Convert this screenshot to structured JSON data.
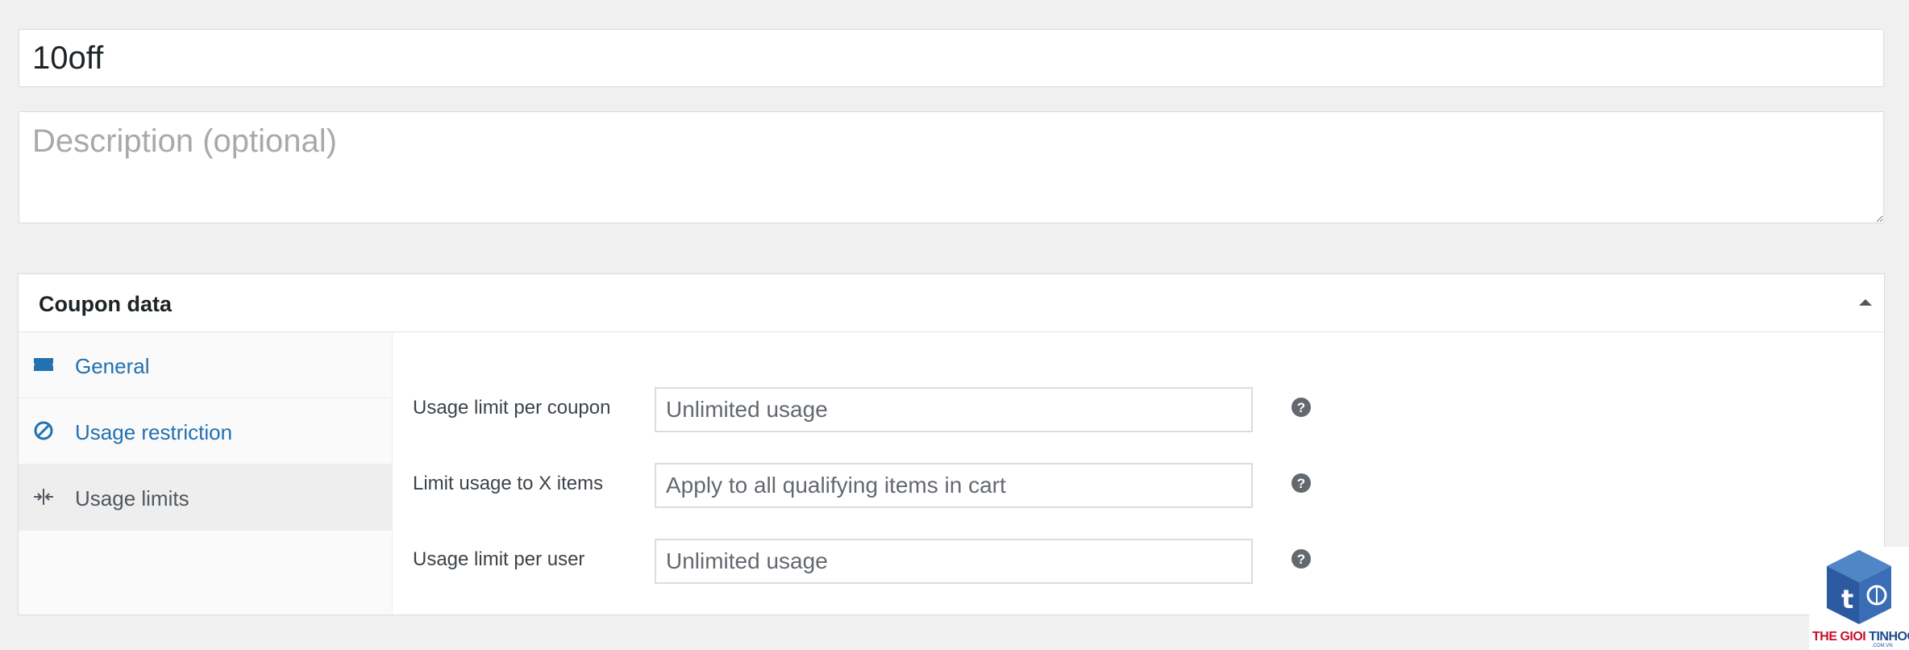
{
  "coupon": {
    "code": "10off",
    "description_placeholder": "Description (optional)"
  },
  "metabox": {
    "title": "Coupon data"
  },
  "tabs": [
    {
      "label": "General",
      "icon": "ticket-icon"
    },
    {
      "label": "Usage restriction",
      "icon": "prohibited-icon"
    },
    {
      "label": "Usage limits",
      "icon": "limits-icon",
      "active": true
    }
  ],
  "fields": [
    {
      "label": "Usage limit per coupon",
      "placeholder": "Unlimited usage"
    },
    {
      "label": "Limit usage to X items",
      "placeholder": "Apply to all qualifying items in cart"
    },
    {
      "label": "Usage limit per user",
      "placeholder": "Unlimited usage"
    }
  ],
  "watermark": {
    "text_part1": "THE GIOI",
    "text_part2": " TINHOC",
    "sub": ".COM.VN"
  },
  "colors": {
    "link": "#2271b1",
    "active_tab_bg": "#eeeeee",
    "page_bg": "#f0f0f1"
  }
}
